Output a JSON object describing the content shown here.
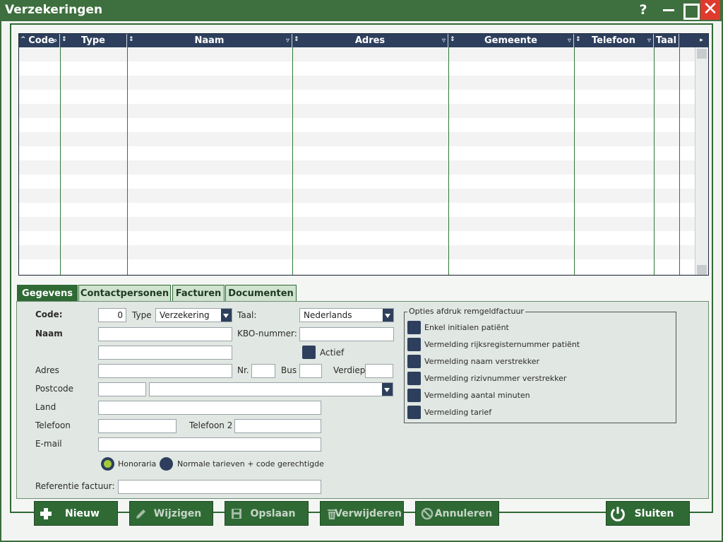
{
  "window": {
    "title": "Verzekeringen",
    "help": "?",
    "close": "✕"
  },
  "grid": {
    "columns": [
      {
        "label": "Code",
        "sort": "^",
        "filter": "⌕"
      },
      {
        "label": "Type",
        "sort": "↕",
        "filter": ""
      },
      {
        "label": "Naam",
        "sort": "↕",
        "filter": "▿"
      },
      {
        "label": "Adres",
        "sort": "↕",
        "filter": "▿"
      },
      {
        "label": "Gemeente",
        "sort": "↕",
        "filter": "▿"
      },
      {
        "label": "Telefoon",
        "sort": "↕",
        "filter": "▿"
      },
      {
        "label": "Taal",
        "sort": "",
        "filter": ""
      },
      {
        "label": "",
        "sort": "",
        "filter": ""
      }
    ],
    "corner": "▸"
  },
  "tabs": [
    {
      "label": "Gegevens",
      "active": true
    },
    {
      "label": "Contactpersonen",
      "active": false
    },
    {
      "label": "Facturen",
      "active": false
    },
    {
      "label": "Documenten",
      "active": false
    }
  ],
  "form": {
    "code_label": "Code:",
    "code_value": "0",
    "type_label": "Type",
    "type_value": "Verzekering",
    "taal_label": "Taal:",
    "taal_value": "Nederlands",
    "naam_label": "Naam",
    "kbo_label": "KBO-nummer:",
    "actief_label": "Actief",
    "adres_label": "Adres",
    "nr_label": "Nr.",
    "bus_label": "Bus",
    "verdiep_label": "Verdiep",
    "postcode_label": "Postcode",
    "land_label": "Land",
    "telefoon_label": "Telefoon",
    "telefoon2_label": "Telefoon 2",
    "email_label": "E-mail",
    "honoraria_label": "Honoraria",
    "normale_label": "Normale tarieven + code gerechtigde",
    "referentie_label": "Referentie factuur:"
  },
  "options": {
    "title": "Opties afdruk remgeldfactuur",
    "items": [
      "Enkel initialen patiënt",
      "Vermelding rijksregisternummer patiënt",
      "Vermelding naam verstrekker",
      "Vermelding rizivnummer verstrekker",
      "Vermelding aantal minuten",
      "Vermelding tarief"
    ]
  },
  "buttons": {
    "nieuw": "Nieuw",
    "wijzigen": "Wijzigen",
    "opslaan": "Opslaan",
    "verwijderen": "Verwijderen",
    "annuleren": "Annuleren",
    "sluiten": "Sluiten"
  },
  "colors": {
    "accent_green": "#2f6a35",
    "header_navy": "#2d3f5c",
    "close_red": "#e03a2f",
    "radio_on": "#a4c83c"
  }
}
